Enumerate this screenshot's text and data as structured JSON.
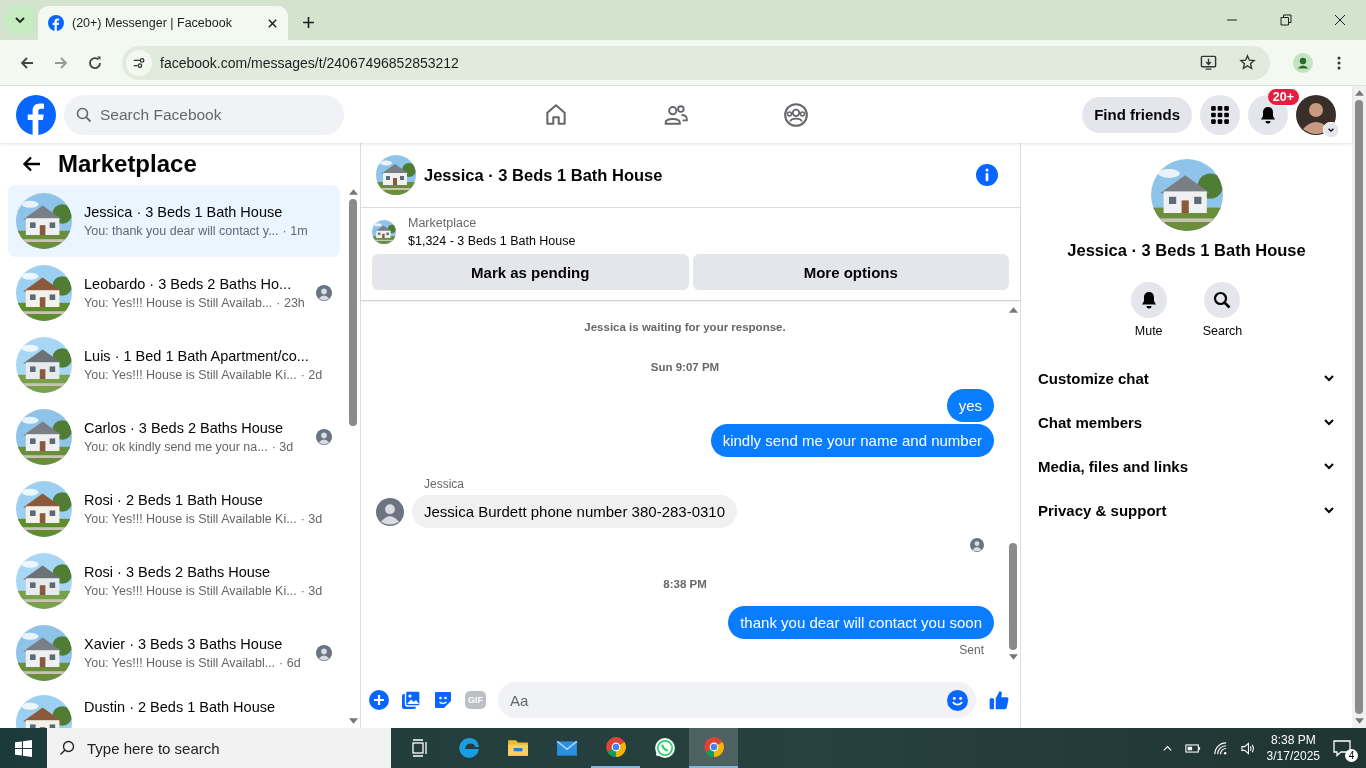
{
  "browser": {
    "tab_title": "(20+) Messenger | Facebook",
    "address": "facebook.com/messages/t/24067496852853212"
  },
  "header": {
    "search_placeholder": "Search Facebook",
    "find_friends": "Find friends",
    "notification_badge": "20+",
    "nav": [
      {
        "kind": "home",
        "selected": false
      },
      {
        "kind": "friends",
        "selected": false
      },
      {
        "kind": "groups",
        "selected": false
      }
    ]
  },
  "sidebar": {
    "title": "Marketplace",
    "conversations": [
      {
        "title": "Jessica · 3 Beds 1 Bath House",
        "preview": "You: thank you dear will contact y...",
        "time": "· 1m",
        "selected": true,
        "seen_avatar": false
      },
      {
        "title": "Leobardo · 3 Beds 2 Baths Ho...",
        "preview": "You: Yes!!! House is Still Availab...",
        "time": "· 23h",
        "selected": false,
        "seen_avatar": true
      },
      {
        "title": "Luis · 1 Bed 1 Bath Apartment/co...",
        "preview": "You: Yes!!! House is Still Available Ki...",
        "time": "· 2d",
        "selected": false,
        "seen_avatar": false
      },
      {
        "title": "Carlos · 3 Beds 2 Baths House",
        "preview": "You: ok kindly send me your na...",
        "time": "· 3d",
        "selected": false,
        "seen_avatar": true
      },
      {
        "title": "Rosi · 2 Beds 1 Bath House",
        "preview": "You: Yes!!! House is Still Available Ki...",
        "time": "· 3d",
        "selected": false,
        "seen_avatar": false
      },
      {
        "title": "Rosi · 3 Beds 2 Baths House",
        "preview": "You: Yes!!! House is Still Available Ki...",
        "time": "· 3d",
        "selected": false,
        "seen_avatar": false
      },
      {
        "title": "Xavier · 3 Beds 3 Baths House",
        "preview": "You: Yes!!! House is Still Availabl...",
        "time": "· 6d",
        "selected": false,
        "seen_avatar": true
      },
      {
        "title": "Dustin · 2 Beds 1 Bath House",
        "selected": false,
        "seen_avatar": false
      }
    ]
  },
  "chat": {
    "title": "Jessica · 3 Beds 1 Bath House",
    "listing": {
      "label": "Marketplace",
      "price": "$1,324 - 3 Beds 1 Bath House"
    },
    "buttons": [
      "Mark as pending",
      "More options"
    ],
    "messages": [
      {
        "kind": "notice",
        "text": "Jessica is waiting for your response."
      },
      {
        "kind": "time",
        "text": "Sun 9:07 PM"
      },
      {
        "kind": "out",
        "text": "yes"
      },
      {
        "kind": "out",
        "text": "kindly send me your name and number"
      },
      {
        "kind": "sender",
        "text": "Jessica"
      },
      {
        "kind": "in",
        "text": "Jessica Burdett phone number 380-283-0310"
      },
      {
        "kind": "seen"
      },
      {
        "kind": "time",
        "text": "8:38 PM"
      },
      {
        "kind": "out",
        "text": "thank you dear will contact you soon"
      },
      {
        "kind": "status",
        "text": "Sent"
      }
    ],
    "composer": {
      "placeholder": "Aa",
      "gif_label": "GIF"
    }
  },
  "details": {
    "title": "Jessica · 3 Beds 1 Bath House",
    "actions": [
      {
        "kind": "mute",
        "label": "Mute"
      },
      {
        "kind": "search",
        "label": "Search"
      }
    ],
    "sections": [
      {
        "label": "Customize chat",
        "expanded": false
      },
      {
        "label": "Chat members",
        "expanded": false
      },
      {
        "label": "Media, files and links",
        "expanded": false
      },
      {
        "label": "Privacy & support",
        "expanded": false
      }
    ]
  },
  "taskbar": {
    "search_placeholder": "Type here to search",
    "apps": [
      {
        "kind": "taskview",
        "running": false,
        "selected": false
      },
      {
        "kind": "edge",
        "running": false,
        "selected": false
      },
      {
        "kind": "folder",
        "running": false,
        "selected": false
      },
      {
        "kind": "mail",
        "running": false,
        "selected": false
      },
      {
        "kind": "chrome",
        "running": true,
        "selected": false
      },
      {
        "kind": "whatsapp",
        "running": false,
        "selected": false
      },
      {
        "kind": "chrome",
        "running": true,
        "selected": true
      }
    ],
    "time": "8:38 PM",
    "date": "3/17/2025",
    "notifications": "4"
  }
}
